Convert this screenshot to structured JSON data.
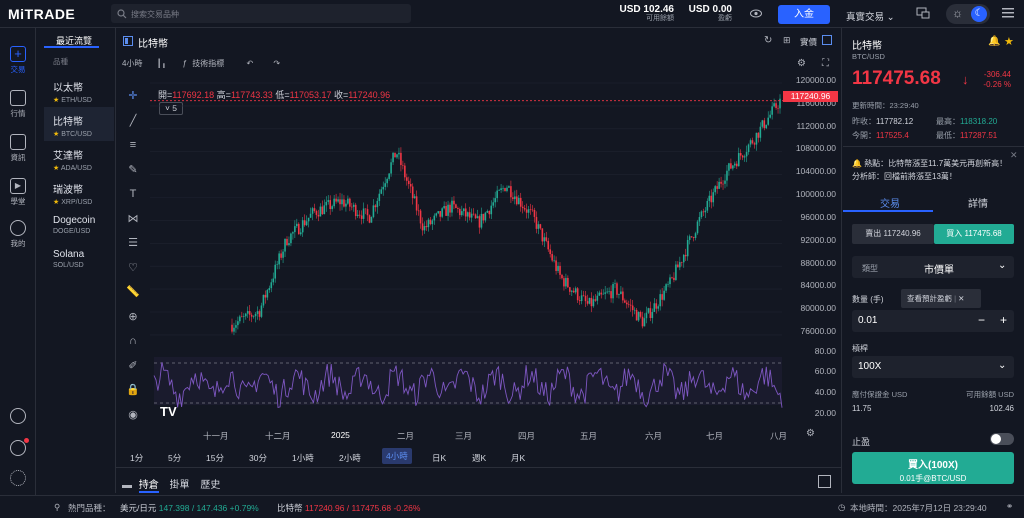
{
  "app": {
    "logo": "MiTRADE",
    "search_placeholder": "搜索交易品种"
  },
  "header": {
    "balance_value": "USD 102.46",
    "balance_label": "可用餘額",
    "pnl_value": "USD 0.00",
    "pnl_label": "盈虧",
    "deposit": "入金",
    "account_mode": "真實交易"
  },
  "nav": [
    {
      "label": "交易",
      "icon": "plus-square-icon"
    },
    {
      "label": "行情",
      "icon": "chart-icon"
    },
    {
      "label": "資訊",
      "icon": "news-icon"
    },
    {
      "label": "學堂",
      "icon": "play-icon"
    },
    {
      "label": "我的",
      "icon": "user-icon"
    }
  ],
  "watchlist": {
    "tab": "最近流覽",
    "col": "品種",
    "items": [
      {
        "name": "以太幣",
        "symbol": "ETH/USD",
        "star": true
      },
      {
        "name": "比特幣",
        "symbol": "BTC/USD",
        "star": true
      },
      {
        "name": "艾達幣",
        "symbol": "ADA/USD",
        "star": true
      },
      {
        "name": "瑞波幣",
        "symbol": "XRP/USD",
        "star": true
      },
      {
        "name": "Dogecoin",
        "symbol": "DOGE/USD",
        "star": false
      },
      {
        "name": "Solana",
        "symbol": "SOL/USD",
        "star": false
      }
    ]
  },
  "chart_header": {
    "title": "比特幣",
    "mode": "實價",
    "interval": "4小時",
    "indicators": "技術指標",
    "layers": "5"
  },
  "ohlc": {
    "o_label": "開=",
    "o": "117692.18",
    "h_label": "高=",
    "h": "117743.33",
    "l_label": "低=",
    "l": "117053.17",
    "c_label": "收=",
    "c": "117240.96"
  },
  "chart_data": {
    "type": "candlestick",
    "price_axis": [
      "120000.00",
      "116000.00",
      "112000.00",
      "108000.00",
      "104000.00",
      "100000.00",
      "96000.00",
      "92000.00",
      "88000.00",
      "84000.00",
      "80000.00",
      "76000.00"
    ],
    "ylim": [
      75000,
      121000
    ],
    "last_price": "117240.96",
    "x_ticks": [
      "十一月",
      "十二月",
      "2025",
      "二月",
      "三月",
      "四月",
      "五月",
      "六月",
      "七月",
      "八月"
    ],
    "rsi_axis": [
      "80.00",
      "60.00",
      "40.00",
      "20.00"
    ],
    "rsi_levels": [
      70,
      30
    ],
    "close_path": [
      [
        0,
        76500
      ],
      [
        0.05,
        79000
      ],
      [
        0.1,
        92000
      ],
      [
        0.15,
        97000
      ],
      [
        0.2,
        99000
      ],
      [
        0.25,
        96000
      ],
      [
        0.3,
        108000
      ],
      [
        0.35,
        94000
      ],
      [
        0.4,
        98000
      ],
      [
        0.45,
        95000
      ],
      [
        0.5,
        102000
      ],
      [
        0.55,
        96000
      ],
      [
        0.6,
        85000
      ],
      [
        0.65,
        80000
      ],
      [
        0.7,
        83000
      ],
      [
        0.75,
        77000
      ],
      [
        0.8,
        84000
      ],
      [
        0.85,
        95000
      ],
      [
        0.9,
        104000
      ],
      [
        0.95,
        110000
      ],
      [
        1.0,
        117240
      ]
    ]
  },
  "timeframes": [
    "1分",
    "5分",
    "15分",
    "30分",
    "1小時",
    "2小時",
    "4小時",
    "日K",
    "週K",
    "月K"
  ],
  "timeframe_selected": "4小時",
  "bottom_tabs": [
    "持倉",
    "掛單",
    "歷史"
  ],
  "product": {
    "name": "比特幣",
    "symbol": "BTC/USD",
    "price": "117475.68",
    "change": "-306.44",
    "change_pct": "-0.26 %",
    "update_time": "更新時間：23:29:40",
    "prev_close_label": "昨收：",
    "prev_close": "117782.12",
    "high_label": "最高：",
    "high": "118318.20",
    "open_label": "今開：",
    "open": "117525.4",
    "low_label": "最低：",
    "low": "117287.51"
  },
  "news": {
    "tag": "熱點：",
    "text": "比特幣漲至11.7萬美元再創新高！分析師：回檔前將漲至13萬！"
  },
  "trade_tabs": [
    "交易",
    "詳情"
  ],
  "sell": {
    "label": "賣出",
    "price": "117240.96"
  },
  "buy": {
    "label": "買入",
    "price": "117475.68"
  },
  "order_type": {
    "label": "類型",
    "value": "市價單"
  },
  "quantity": {
    "label": "數量 (手)",
    "tooltip": "查看預計盈虧",
    "value": "0.01"
  },
  "leverage": {
    "label": "槓桿",
    "value": "100X"
  },
  "margin": {
    "label": "應付保證金 USD",
    "value": "11.75",
    "avail_label": "可用餘額 USD",
    "avail_value": "102.46"
  },
  "stop_profit": "止盈",
  "buy_button": {
    "line1": "買入(100X)",
    "line2": "0.01手@BTC/USD"
  },
  "footer": {
    "hot_label": "熱門品種：",
    "t1_name": "美元/日元",
    "t1_value": "147.398 / 147.436",
    "t1_change": "+0.79%",
    "t2_name": "比特幣",
    "t2_value": "117240.96 / 117475.68",
    "t2_change": "-0.26%",
    "local_time": "本地時間：2025年7月12日 23:29:40"
  },
  "colors": {
    "up": "#22ab94",
    "down": "#f23645",
    "accent": "#2962ff",
    "rsi": "#7e57c2"
  }
}
